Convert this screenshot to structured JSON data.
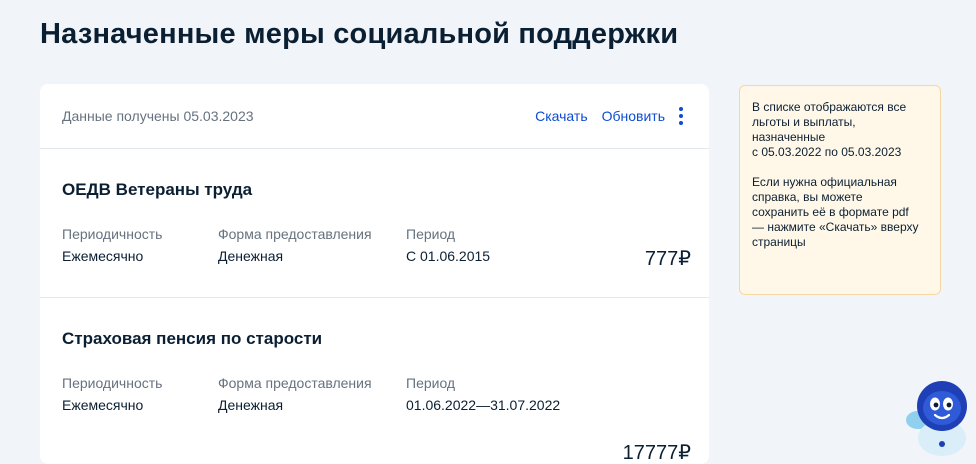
{
  "page_title": "Назначенные меры социальной поддержки",
  "card": {
    "received": "Данные получены 05.03.2023",
    "download_label": "Скачать",
    "refresh_label": "Обновить",
    "more_icon": "kebab-menu-icon"
  },
  "measures": [
    {
      "title": "ОЕДВ Ветераны труда",
      "periodicity_label": "Периодичность",
      "periodicity": "Ежемесячно",
      "form_label": "Форма предоставления",
      "form": "Денежная",
      "period_label": "Период",
      "period": "С 01.06.2015",
      "amount": "777₽"
    },
    {
      "title": "Страховая пенсия по старости",
      "periodicity_label": "Периодичность",
      "periodicity": "Ежемесячно",
      "form_label": "Форма предоставления",
      "form": "Денежная",
      "period_label": "Период",
      "period": "01.06.2022—31.07.2022",
      "amount": "17777₽"
    }
  ],
  "info": {
    "text1": "В списке отображаются все\nльготы и выплаты,\nназначенные\nс 05.03.2022 по 05.03.2023",
    "text2": "Если нужна официальная\nсправка, вы можете\nсохранить её в формате pdf\n— нажмите «Скачать» вверху\nстраницы"
  },
  "assistant_icon": "robot-assistant-icon",
  "colors": {
    "accent": "#0d4cd3",
    "background": "#f1f4f8",
    "info_bg": "#fff8e8",
    "info_border": "#f7d7a1",
    "text": "#0b1f33",
    "muted": "#66727f"
  }
}
